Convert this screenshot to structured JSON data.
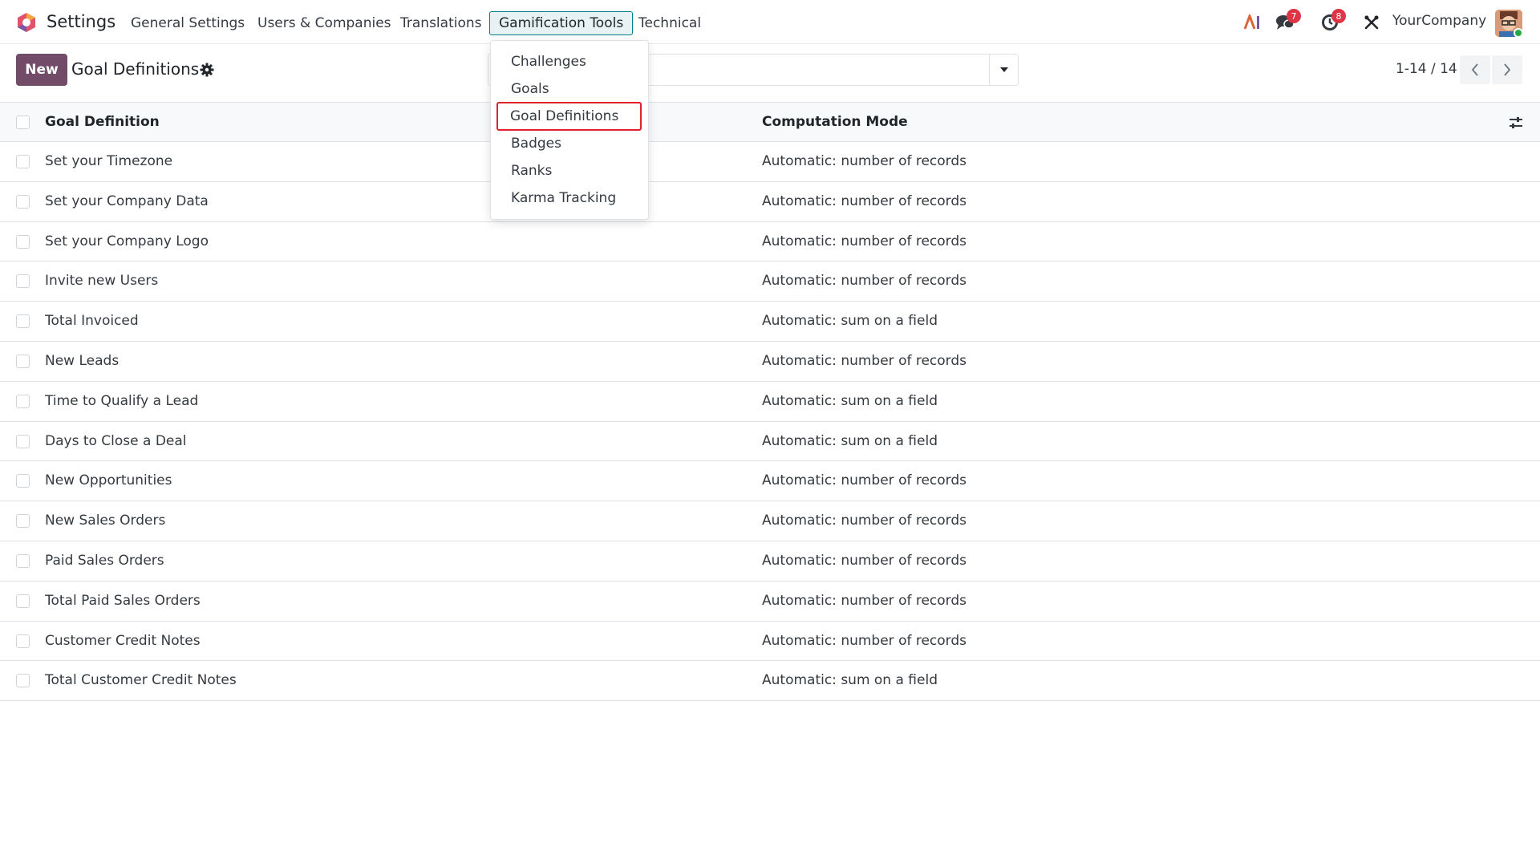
{
  "navbar": {
    "app_name": "Settings",
    "menus": [
      {
        "label": "General Settings"
      },
      {
        "label": "Users & Companies"
      },
      {
        "label": "Translations"
      },
      {
        "label": "Gamification Tools"
      },
      {
        "label": "Technical"
      }
    ],
    "active_menu": "Gamification Tools",
    "icons": {
      "ai": "ai-icon",
      "messages": "chat-bubbles-icon",
      "activities": "clock-icon",
      "debug": "tools-icon"
    },
    "messages_count": "7",
    "activities_count": "8",
    "company": "YourCompany"
  },
  "control_panel": {
    "new_label": "New",
    "title": "Goal Definitions",
    "pager": "1-14 / 14"
  },
  "dropdown": {
    "items": [
      {
        "label": "Challenges"
      },
      {
        "label": "Goals"
      },
      {
        "label": "Goal Definitions"
      },
      {
        "label": "Badges"
      },
      {
        "label": "Ranks"
      },
      {
        "label": "Karma Tracking"
      }
    ],
    "highlighted": "Goal Definitions"
  },
  "list": {
    "columns": [
      "Goal Definition",
      "Computation Mode"
    ],
    "rows": [
      {
        "name": "Set your Timezone",
        "mode": "Automatic: number of records"
      },
      {
        "name": "Set your Company Data",
        "mode": "Automatic: number of records"
      },
      {
        "name": "Set your Company Logo",
        "mode": "Automatic: number of records"
      },
      {
        "name": "Invite new Users",
        "mode": "Automatic: number of records"
      },
      {
        "name": "Total Invoiced",
        "mode": "Automatic: sum on a field"
      },
      {
        "name": "New Leads",
        "mode": "Automatic: number of records"
      },
      {
        "name": "Time to Qualify a Lead",
        "mode": "Automatic: sum on a field"
      },
      {
        "name": "Days to Close a Deal",
        "mode": "Automatic: sum on a field"
      },
      {
        "name": "New Opportunities",
        "mode": "Automatic: number of records"
      },
      {
        "name": "New Sales Orders",
        "mode": "Automatic: number of records"
      },
      {
        "name": "Paid Sales Orders",
        "mode": "Automatic: number of records"
      },
      {
        "name": "Total Paid Sales Orders",
        "mode": "Automatic: number of records"
      },
      {
        "name": "Customer Credit Notes",
        "mode": "Automatic: number of records"
      },
      {
        "name": "Total Customer Credit Notes",
        "mode": "Automatic: sum on a field"
      }
    ]
  },
  "colors": {
    "brand": "#714b67",
    "accent": "#017e84",
    "highlight_box": "#e0202a",
    "badge": "#dc3545"
  }
}
